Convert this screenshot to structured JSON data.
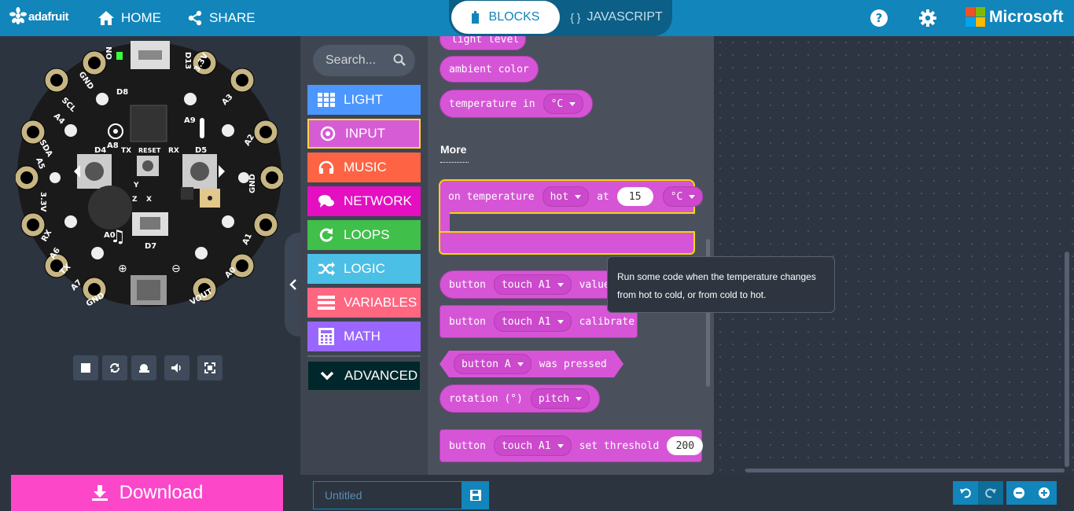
{
  "header": {
    "logo_text": "adafruit",
    "home_label": "HOME",
    "share_label": "SHARE",
    "tabs": {
      "blocks": "BLOCKS",
      "javascript": "JAVASCRIPT",
      "javascript_icon": "{ }"
    },
    "microsoft_label": "Microsoft"
  },
  "board": {
    "pins": {
      "d8": "D8",
      "d13": "D13",
      "on": "ON",
      "gnd1": "GND",
      "scl": "SCL",
      "a4": "A4",
      "sda": "SDA",
      "a5": "A5",
      "v33_left": "3.3V",
      "rx": "RX",
      "a6": "A6",
      "tx": "TX",
      "a7": "A7",
      "gnd2": "GND",
      "v33_right": "3.3V",
      "a3": "A3",
      "a2": "A2",
      "gnd3": "GND",
      "a1": "A1",
      "a0_right": "A0",
      "vout": "VOUT",
      "a9": "A9",
      "a8": "A8",
      "d4": "D4",
      "d5": "D5",
      "tx_mid": "TX",
      "reset": "RESET",
      "rx_mid": "RX",
      "a0_mid": "A0",
      "d7": "D7",
      "y": "Y",
      "z": "Z",
      "x": "X"
    }
  },
  "toolbox": {
    "search_placeholder": "Search...",
    "categories": [
      {
        "label": "LIGHT",
        "color": "#4c97ff",
        "icon": "grid-icon"
      },
      {
        "label": "INPUT",
        "color": "#d65cd6",
        "icon": "target-icon"
      },
      {
        "label": "MUSIC",
        "color": "#fe6444",
        "icon": "headphones-icon"
      },
      {
        "label": "NETWORK",
        "color": "#e30fc0",
        "icon": "chat-icon"
      },
      {
        "label": "LOOPS",
        "color": "#40bf4a",
        "icon": "loop-icon"
      },
      {
        "label": "LOGIC",
        "color": "#4cbfe6",
        "icon": "shuffle-icon"
      },
      {
        "label": "VARIABLES",
        "color": "#ff6680",
        "icon": "list-icon"
      },
      {
        "label": "MATH",
        "color": "#9966ff",
        "icon": "calculator-icon"
      },
      {
        "label": "ADVANCED",
        "color": "#00272b",
        "icon": "chevron-down-icon"
      }
    ]
  },
  "flyout": {
    "light_level": "light level",
    "ambient_color": "ambient color",
    "temperature_in": "temperature in",
    "temp_unit": "°C",
    "more_heading": "More",
    "on_temperature": {
      "prefix": "on temperature",
      "condition": "hot",
      "at": "at",
      "value": "15",
      "unit": "°C"
    },
    "button_value": {
      "prefix": "button",
      "pin": "touch A1",
      "suffix": "value"
    },
    "button_calibrate": {
      "prefix": "button",
      "pin": "touch A1",
      "suffix": "calibrate"
    },
    "button_pressed": {
      "button": "button A",
      "suffix": "was pressed"
    },
    "rotation": {
      "prefix": "rotation (°)",
      "axis": "pitch"
    },
    "set_threshold": {
      "prefix": "button",
      "pin": "touch A1",
      "suffix": "set threshold",
      "value": "200"
    }
  },
  "tooltip": {
    "line1": "Run some code when the temperature changes",
    "line2": "from hot to cold, or from cold to hot."
  },
  "footer": {
    "download_label": "Download",
    "project_placeholder": "Untitled"
  }
}
